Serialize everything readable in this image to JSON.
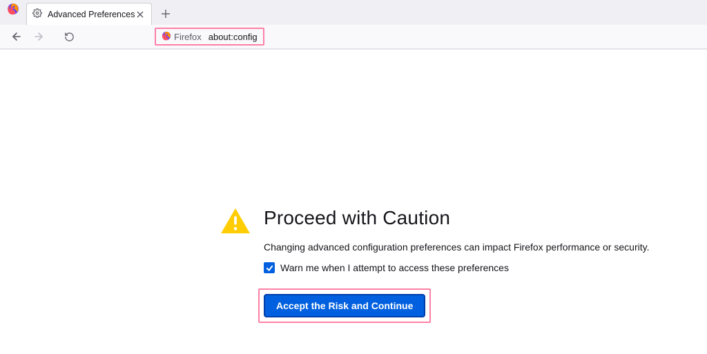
{
  "browser": {
    "tab": {
      "title": "Advanced Preferences"
    },
    "urlbar": {
      "product": "Firefox",
      "location": "about:config"
    }
  },
  "warning": {
    "title": "Proceed with Caution",
    "description": "Changing advanced configuration preferences can impact Firefox performance or security.",
    "checkbox_label": "Warn me when I attempt to access these preferences",
    "checkbox_checked": true,
    "accept_label": "Accept the Risk and Continue"
  },
  "colors": {
    "highlight": "#ff7fa5",
    "primary": "#0060df"
  }
}
